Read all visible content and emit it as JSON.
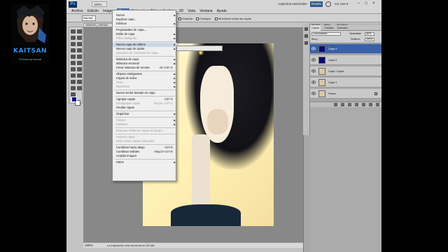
{
  "channel": {
    "overlay_text": "KAITSAN",
    "overlay_sub": "Photoshop tutorial"
  },
  "app": {
    "logo": "Ps",
    "zoom_display": "100%",
    "workspace": "Aspectos esenciales",
    "design_button": "Diseño",
    "cs_live": "CS Live ▾"
  },
  "menubar": {
    "items": [
      "Archivo",
      "Edición",
      "Imagen",
      "Capa",
      "Selección",
      "Filtro",
      "Análisis",
      "3D",
      "Vista",
      "Ventana",
      "Ayuda"
    ],
    "active": "Capa"
  },
  "options": {
    "tool_mode": "Normal",
    "sample_all": "Muestrear todas las capas",
    "contiguous": "Contiguo",
    "antialias": "Suavizar"
  },
  "document": {
    "tab": "19383331_1082462..."
  },
  "status": {
    "zoom": "100%",
    "text": "La exposición sólo funciona en 32 bits"
  },
  "layer_menu": {
    "items": [
      {
        "label": "Nuevo",
        "shortcut": "",
        "submenu": true,
        "disabled": false
      },
      {
        "label": "Duplicar capa...",
        "shortcut": "",
        "submenu": false,
        "disabled": false
      },
      {
        "label": "Eliminar",
        "shortcut": "",
        "submenu": true,
        "disabled": false
      },
      {
        "sep": true
      },
      {
        "label": "Propiedades de capa...",
        "shortcut": "",
        "submenu": false,
        "disabled": false
      },
      {
        "label": "Estilo de capa",
        "shortcut": "",
        "submenu": true,
        "disabled": false
      },
      {
        "label": "Filtro inteligente",
        "shortcut": "",
        "submenu": true,
        "disabled": true
      },
      {
        "sep": true
      },
      {
        "label": "Nueva capa de relleno",
        "shortcut": "",
        "submenu": true,
        "disabled": false,
        "highlight": true
      },
      {
        "label": "Nueva capa de ajuste",
        "shortcut": "",
        "submenu": true,
        "disabled": false
      },
      {
        "label": "Opciones de contenido de capa...",
        "shortcut": "",
        "submenu": false,
        "disabled": true
      },
      {
        "sep": true
      },
      {
        "label": "Máscara de capa",
        "shortcut": "",
        "submenu": true,
        "disabled": false
      },
      {
        "label": "Máscara vectorial",
        "shortcut": "",
        "submenu": true,
        "disabled": false
      },
      {
        "label": "Crear máscara de recorte",
        "shortcut": "Alt+Ctrl+G",
        "submenu": false,
        "disabled": false
      },
      {
        "sep": true
      },
      {
        "label": "Objetos inteligentes",
        "shortcut": "",
        "submenu": true,
        "disabled": false
      },
      {
        "label": "Capas de vídeo",
        "shortcut": "",
        "submenu": true,
        "disabled": false
      },
      {
        "label": "Texto",
        "shortcut": "",
        "submenu": true,
        "disabled": true
      },
      {
        "label": "Rasterizar",
        "shortcut": "",
        "submenu": true,
        "disabled": true
      },
      {
        "sep": true
      },
      {
        "label": "Nuevo sector basado en capa",
        "shortcut": "",
        "submenu": false,
        "disabled": false
      },
      {
        "sep": true
      },
      {
        "label": "Agrupar capas",
        "shortcut": "Ctrl+G",
        "submenu": false,
        "disabled": false
      },
      {
        "label": "Desagrupar capas",
        "shortcut": "Mayús+Ctrl+G",
        "submenu": false,
        "disabled": true
      },
      {
        "label": "Ocultar capas",
        "shortcut": "",
        "submenu": false,
        "disabled": false
      },
      {
        "sep": true
      },
      {
        "label": "Organizar",
        "shortcut": "",
        "submenu": true,
        "disabled": false
      },
      {
        "sep": true
      },
      {
        "label": "Alinear",
        "shortcut": "",
        "submenu": true,
        "disabled": true
      },
      {
        "label": "Distribuir",
        "shortcut": "",
        "submenu": true,
        "disabled": true
      },
      {
        "sep": true
      },
      {
        "label": "Bloquear todas las capas del grupo...",
        "shortcut": "",
        "submenu": false,
        "disabled": true
      },
      {
        "sep": true
      },
      {
        "label": "Enlazar capas",
        "shortcut": "",
        "submenu": false,
        "disabled": true
      },
      {
        "label": "Seleccionar capas enlazadas",
        "shortcut": "",
        "submenu": false,
        "disabled": true
      },
      {
        "sep": true
      },
      {
        "label": "Combinar hacia abajo",
        "shortcut": "Ctrl+E",
        "submenu": false,
        "disabled": false
      },
      {
        "label": "Combinar visibles",
        "shortcut": "Mayús+Ctrl+E",
        "submenu": false,
        "disabled": false
      },
      {
        "label": "Acoplar imagen",
        "shortcut": "",
        "submenu": false,
        "disabled": false
      },
      {
        "sep": true
      },
      {
        "label": "Halos",
        "shortcut": "",
        "submenu": true,
        "disabled": false
      }
    ]
  },
  "panel": {
    "tabs": [
      "Capas",
      "Canales",
      "Trazados"
    ],
    "top_tabs": [
      "Muestras",
      "Estilos",
      "Información"
    ],
    "blend_mode": "Luminosidad",
    "opacity_label": "Opacidad:",
    "opacity_value": "80%",
    "fill_label": "Relleno:",
    "fill_value": "100%",
    "lock_label": "Bloq.:",
    "layers": [
      {
        "name": "Capa 4",
        "selected": true,
        "thumb": "#0a0a70"
      },
      {
        "name": "Capa 2",
        "selected": false,
        "thumb": "#0a0a70"
      },
      {
        "name": "Capa 1 copia",
        "selected": false,
        "thumb": "#d9c7a8"
      },
      {
        "name": "Capa 1",
        "selected": false,
        "thumb": "#d9c7a8"
      },
      {
        "name": "Fondo",
        "selected": false,
        "thumb": "#d9c7a8"
      }
    ]
  },
  "colors": {
    "accent": "#3a61a8",
    "fg_swatch": "#0a0a8a"
  }
}
